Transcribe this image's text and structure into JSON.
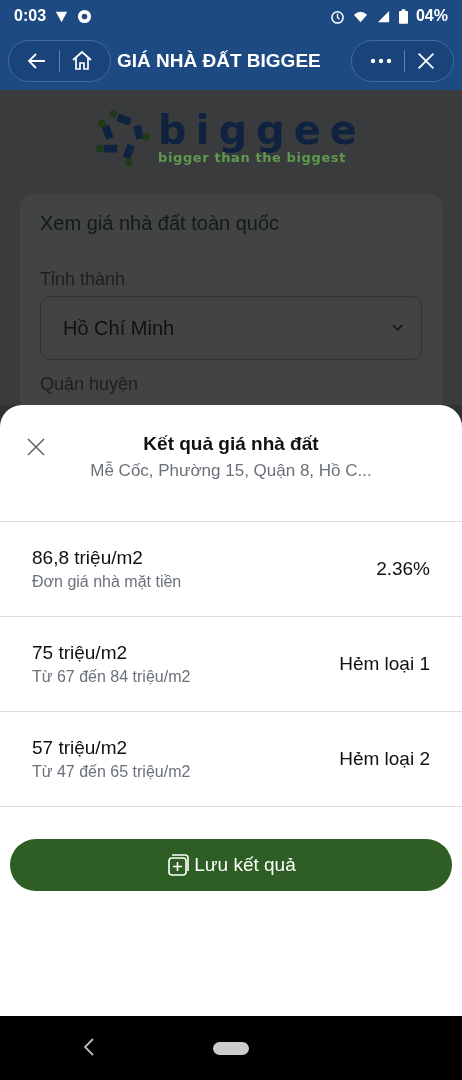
{
  "status_bar": {
    "time": "0:03",
    "battery": "04%"
  },
  "toolbar": {
    "title": "GIÁ NHÀ ĐẤT BIGGEE"
  },
  "logo": {
    "name": "biggee",
    "tagline": "bigger than the biggest"
  },
  "form": {
    "title": "Xem giá nhà đất toàn quốc",
    "province_label": "Tỉnh thành",
    "province_value": "Hồ Chí Minh",
    "district_label": "Quận huyện"
  },
  "sheet": {
    "title": "Kết quả giá nhà đất",
    "subtitle": "Mễ Cốc, Phường 15, Quận 8, Hồ C...",
    "results": [
      {
        "price": "86,8 triệu/m2",
        "detail": "Đơn giá nhà mặt tiền",
        "side": "2.36%"
      },
      {
        "price": "75 triệu/m2",
        "detail": "Từ 67 đến 84 triệu/m2",
        "side": "Hẻm loại 1"
      },
      {
        "price": "57 triệu/m2",
        "detail": "Từ 47 đến 65 triệu/m2",
        "side": "Hẻm loại 2"
      }
    ],
    "save_button": "Lưu kết quả"
  }
}
